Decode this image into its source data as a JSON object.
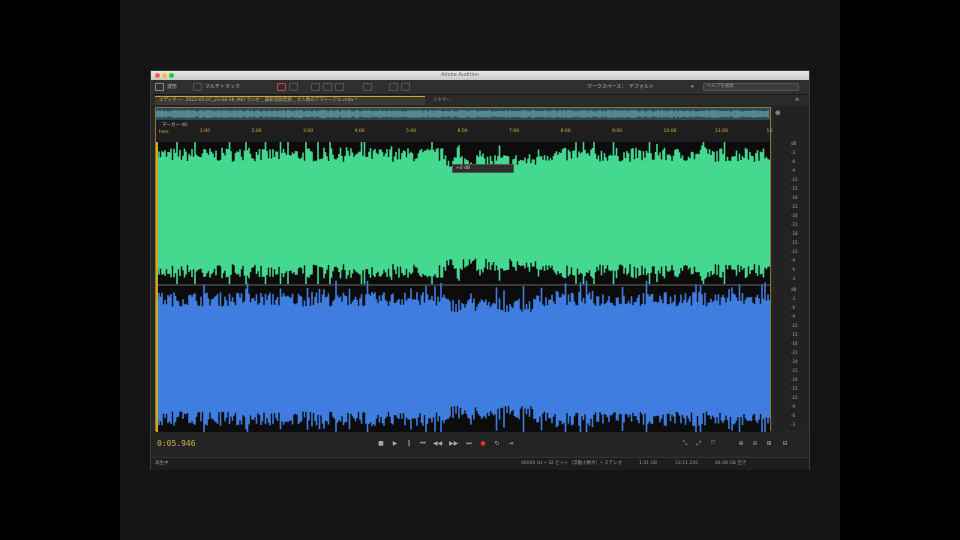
{
  "app": {
    "title": "Adobe Audition"
  },
  "toolbar": {
    "waveform_label": "波形",
    "multitrack_label": "マルチトラック",
    "workspace_label": "ワークスペース：",
    "workspace_value": "デフォルト",
    "search_placeholder": "ヘルプを検索"
  },
  "tabs": {
    "document": "エディター：2022-05-07_23-08-58_MEI ラジオ _ 最新収録音源 _ 大人数のアマトーアル.m4a *",
    "mixer": "ミキサー"
  },
  "ruler": {
    "marker_label": "マーカー (6)",
    "hms": "hms",
    "ticks": [
      "1:00",
      "2:00",
      "3:00",
      "4:00",
      "5:00",
      "6:00",
      "7:00",
      "8:00",
      "9:00",
      "10:00",
      "11:00",
      "12:00"
    ]
  },
  "hud": {
    "value": "+0 dB"
  },
  "right_scale": {
    "top": [
      "dB",
      "-3",
      "-6",
      "-9",
      "-12",
      "-15",
      "-18",
      "-21",
      "-24",
      "-21",
      "-18",
      "-15",
      "-12",
      "-9",
      "-6",
      "-3"
    ],
    "bottom": [
      "dB",
      "-3",
      "-6",
      "-9",
      "-12",
      "-15",
      "-18",
      "-21",
      "-24",
      "-21",
      "-18",
      "-15",
      "-12",
      "-9",
      "-6",
      "-3"
    ]
  },
  "transport": {
    "timecode": "0:05.946"
  },
  "status": {
    "left": "再生中",
    "format": "48000 Hz • 32 ビット（浮動小数点）• ステレオ",
    "size": "1.41 GB",
    "duration": "33:11.245",
    "free": "84.08 GB 空き"
  },
  "colors": {
    "left_channel": "#45d990",
    "right_channel": "#3f7ee0",
    "accent": "#d2a91e"
  },
  "icons": [
    "zoom-in-icon",
    "zoom-out-icon",
    "play-icon",
    "stop-icon",
    "record-icon",
    "loop-icon",
    "skip-back-icon",
    "skip-forward-icon"
  ]
}
